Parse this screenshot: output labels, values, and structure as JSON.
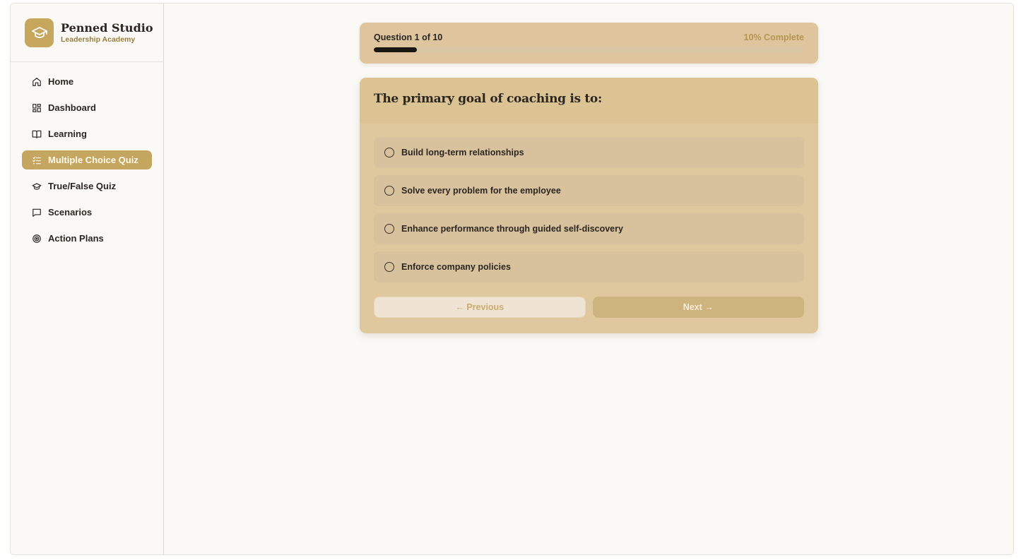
{
  "brand": {
    "name": "Penned Studio",
    "subtitle": "Leadership Academy",
    "logo_icon": "graduation-cap-icon",
    "accent_color": "#c7a75e"
  },
  "sidebar": {
    "items": [
      {
        "label": "Home",
        "icon": "home-icon",
        "active": false
      },
      {
        "label": "Dashboard",
        "icon": "dashboard-icon",
        "active": false
      },
      {
        "label": "Learning",
        "icon": "book-icon",
        "active": false
      },
      {
        "label": "Multiple Choice Quiz",
        "icon": "list-check-icon",
        "active": true
      },
      {
        "label": "True/False Quiz",
        "icon": "graduation-cap-icon",
        "active": false
      },
      {
        "label": "Scenarios",
        "icon": "chat-bubble-icon",
        "active": false
      },
      {
        "label": "Action Plans",
        "icon": "target-icon",
        "active": false
      }
    ]
  },
  "progress": {
    "question_label": "Question 1 of 10",
    "percent_label": "10% Complete",
    "fraction": 0.1
  },
  "quiz": {
    "question": "The primary goal of coaching is to:",
    "options": [
      "Build long-term relationships",
      "Solve every problem for the employee",
      "Enhance performance through guided self-discovery",
      "Enforce company policies"
    ],
    "prev_label": "← Previous",
    "next_label": "Next →"
  }
}
